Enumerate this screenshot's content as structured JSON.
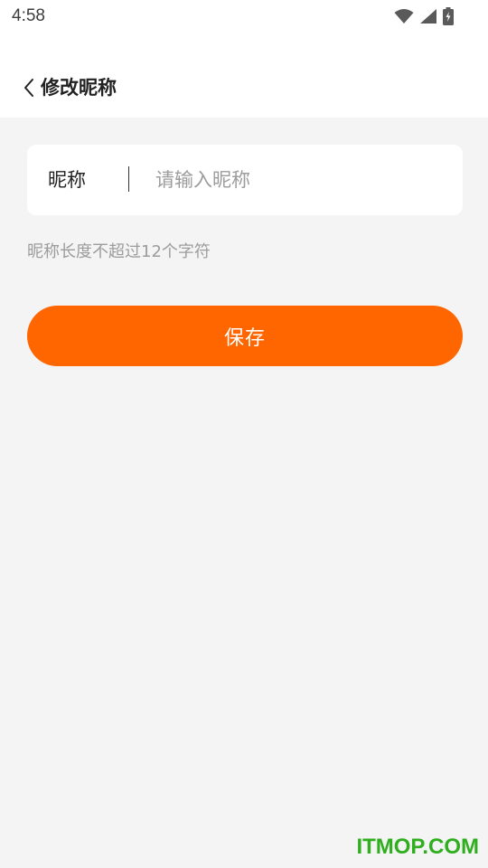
{
  "status_bar": {
    "time": "4:58",
    "icons": [
      "wifi-icon",
      "signal-icon",
      "battery-charging-icon"
    ]
  },
  "header": {
    "back_icon": "chevron-left-icon",
    "title": "修改昵称"
  },
  "form": {
    "label": "昵称",
    "value": "",
    "placeholder": "请输入昵称",
    "hint": "昵称长度不超过12个字符"
  },
  "save_button": {
    "label": "保存"
  },
  "watermark": "ITMOP.COM",
  "colors": {
    "accent": "#ff6600",
    "background": "#f4f4f5",
    "card": "#ffffff",
    "hint_text": "#9c9c9c",
    "watermark": "#2fae1e"
  }
}
